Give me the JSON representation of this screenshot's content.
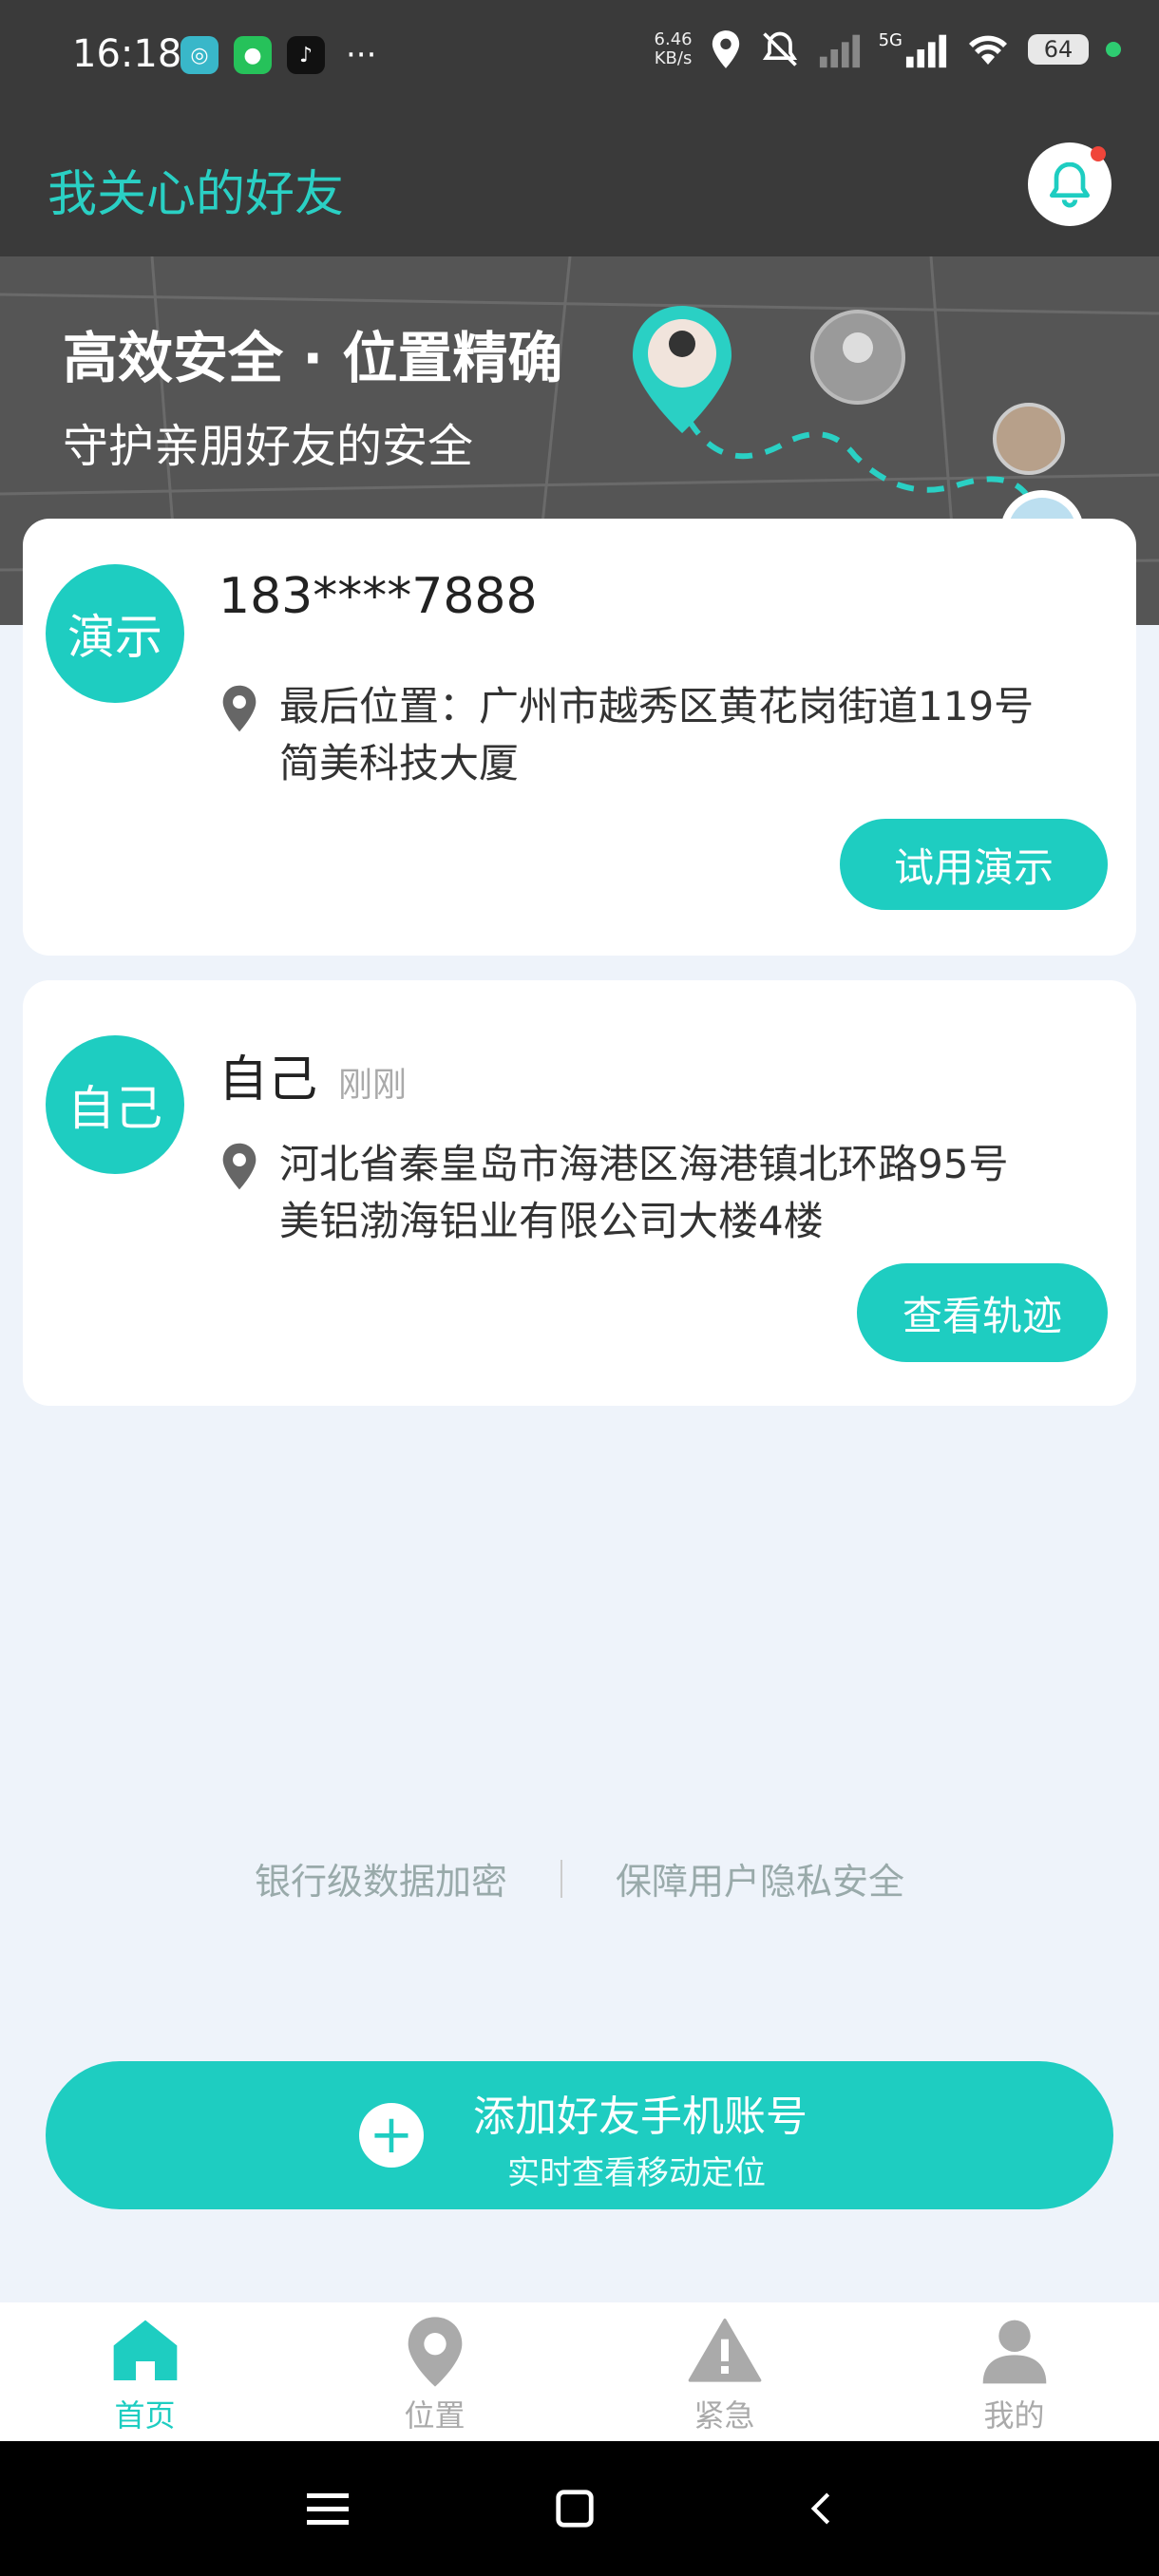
{
  "status_bar": {
    "time": "16:18",
    "network_speed_value": "6.46",
    "network_speed_unit": "KB/s",
    "battery": "64",
    "network": "5G"
  },
  "header": {
    "title": "我关心的好友"
  },
  "banner": {
    "headline": "高效安全 · 位置精确",
    "subline": "守护亲朋好友的安全"
  },
  "cards": [
    {
      "avatar_text": "演示",
      "name": "183****7888",
      "time": "",
      "address_line1": "最后位置：广州市越秀区黄花岗街道119号",
      "address_line2": "简美科技大厦",
      "button_label": "试用演示"
    },
    {
      "avatar_text": "自己",
      "name": "自己",
      "time": "刚刚",
      "address_line1": "河北省秦皇岛市海港区海港镇北环路95号",
      "address_line2": "美铝渤海铝业有限公司大楼4楼",
      "button_label": "查看轨迹"
    }
  ],
  "security": {
    "left": "银行级数据加密",
    "right": "保障用户隐私安全"
  },
  "add_friend": {
    "plus": "+",
    "main": "添加好友手机账号",
    "sub": "实时查看移动定位"
  },
  "tabs": [
    {
      "label": "首页",
      "icon": "home-icon",
      "active": true
    },
    {
      "label": "位置",
      "icon": "location-icon",
      "active": false
    },
    {
      "label": "紧急",
      "icon": "warning-icon",
      "active": false
    },
    {
      "label": "我的",
      "icon": "person-icon",
      "active": false
    }
  ],
  "colors": {
    "accent": "#1ecdc1",
    "header_bg": "#3a3a3a",
    "page_bg": "#eef3fa"
  }
}
